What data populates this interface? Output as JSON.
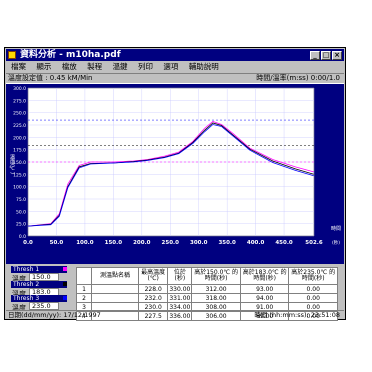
{
  "window": {
    "title": "資料分析 - m10ha.pdf",
    "minimize": "_",
    "maximize": "□",
    "close": "×"
  },
  "menu": [
    "檔案",
    "顯示",
    "檔放",
    "製程",
    "溫鍵",
    "列印",
    "選項",
    "輔助說明"
  ],
  "info": {
    "left": "溫度設定值 : 0.45 kM/Min",
    "right": "時間/溫率(m:ss) 0:00/1.0"
  },
  "chart_data": {
    "type": "line",
    "ylabel": "溫度(℃)",
    "xlabel": "時間",
    "xunit": "(秒)",
    "ylim": [
      0,
      300
    ],
    "xlim": [
      0,
      502.6
    ],
    "yticks": [
      "0.0",
      "25.0",
      "50.0",
      "75.0",
      "100.0",
      "125.0",
      "150.0",
      "175.0",
      "200.0",
      "225.0",
      "250.0",
      "275.0",
      "300.0"
    ],
    "xticks": [
      "0.0",
      "50.0",
      "100.0",
      "150.0",
      "200.0",
      "250.0",
      "300.0",
      "350.0",
      "400.0",
      "450.0",
      "502.6"
    ],
    "thresholds": [
      {
        "name": "Thresh 1",
        "value": 150.0,
        "color": "#ff00ff"
      },
      {
        "name": "Thresh 2",
        "value": 183.0,
        "color": "#000000"
      },
      {
        "name": "Thresh 3",
        "value": 235.0,
        "color": "#0000ff"
      }
    ],
    "series": [
      {
        "color": "#ff00ff",
        "x": [
          0,
          40,
          55,
          70,
          90,
          110,
          150,
          185,
          210,
          240,
          265,
          290,
          310,
          325,
          340,
          360,
          390,
          430,
          470,
          502
        ],
        "y": [
          20,
          25,
          45,
          105,
          143,
          150,
          150,
          152,
          155,
          162,
          170,
          192,
          218,
          232,
          226,
          208,
          178,
          155,
          140,
          130
        ]
      },
      {
        "color": "#000000",
        "x": [
          0,
          40,
          55,
          70,
          90,
          110,
          150,
          185,
          210,
          240,
          265,
          290,
          310,
          325,
          340,
          360,
          390,
          430,
          470,
          502
        ],
        "y": [
          20,
          24,
          42,
          100,
          140,
          147,
          148,
          151,
          154,
          160,
          168,
          190,
          214,
          229,
          224,
          205,
          176,
          152,
          136,
          125
        ]
      },
      {
        "color": "#0000ff",
        "x": [
          0,
          40,
          55,
          70,
          90,
          110,
          150,
          185,
          210,
          240,
          265,
          290,
          310,
          325,
          340,
          360,
          390,
          430,
          470,
          502
        ],
        "y": [
          20,
          23,
          40,
          98,
          138,
          146,
          148,
          150,
          153,
          159,
          167,
          188,
          211,
          226,
          222,
          203,
          174,
          149,
          133,
          122
        ]
      }
    ]
  },
  "thresh_panels": [
    {
      "title": "Thresh 1",
      "label": "溫度",
      "value": "150.0"
    },
    {
      "title": "Thresh 2",
      "label": "溫度",
      "value": "183.0"
    },
    {
      "title": "Thresh 3",
      "label": "溫度",
      "value": "235.0"
    }
  ],
  "table": {
    "headers": [
      "",
      "測溫點名稱",
      "最高溫度 (℃)",
      "位於 (秒)",
      "高於150.0℃ 的時間(秒)",
      "高於183.0℃ 的時間(秒)",
      "高於235.0℃ 的時間(秒)"
    ],
    "rows": [
      [
        "1",
        "",
        "228.0",
        "330.00",
        "312.00",
        "93.00",
        "0.00"
      ],
      [
        "2",
        "",
        "232.0",
        "331.00",
        "318.00",
        "94.00",
        "0.00"
      ],
      [
        "3",
        "",
        "230.0",
        "334.00",
        "308.00",
        "91.00",
        "0.00"
      ],
      [
        "4",
        "",
        "227.5",
        "336.00",
        "306.00",
        "89.00",
        "0.00"
      ]
    ]
  },
  "status": {
    "left": "日期(dd/mm/yy): 17/12/1997",
    "right": "時間 (hh:mm:ss): 23:51:08"
  }
}
